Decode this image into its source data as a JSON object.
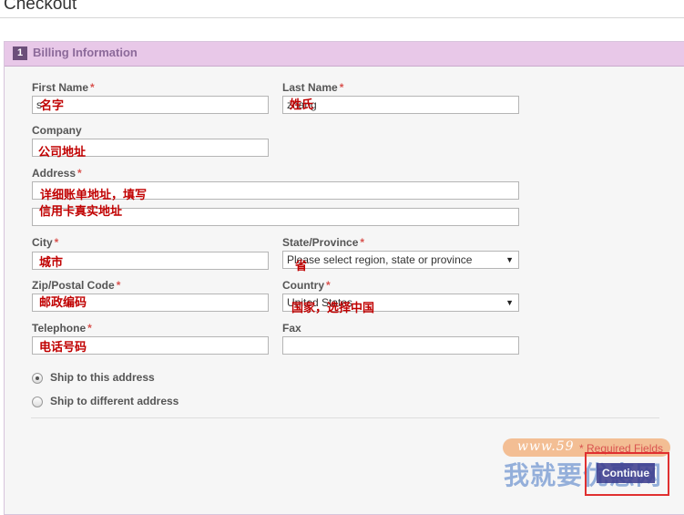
{
  "page": {
    "title": "Checkout"
  },
  "section": {
    "step": "1",
    "title": "Billing Information"
  },
  "fields": {
    "first_name": {
      "label": "First Name",
      "value": "s",
      "note": "名字"
    },
    "last_name": {
      "label": "Last Name",
      "value": "zhang",
      "note": "姓氏"
    },
    "company": {
      "label": "Company",
      "value": "",
      "note": "公司地址"
    },
    "address": {
      "label": "Address",
      "line1": "",
      "line2": "",
      "note1": "详细账单地址，填写",
      "note2": "信用卡真实地址"
    },
    "city": {
      "label": "City",
      "value": "",
      "note": "城市"
    },
    "state": {
      "label": "State/Province",
      "value": "Please select region, state or province",
      "note": "省"
    },
    "zip": {
      "label": "Zip/Postal Code",
      "value": "",
      "note": "邮政编码"
    },
    "country": {
      "label": "Country",
      "value": "United States",
      "note": "国家，选择中国"
    },
    "telephone": {
      "label": "Telephone",
      "value": "",
      "note": "电话号码"
    },
    "fax": {
      "label": "Fax",
      "value": ""
    },
    "required_mark": "*"
  },
  "shipping": {
    "option1": "Ship to this address",
    "option2": "Ship to different address",
    "selected": "option1"
  },
  "footer": {
    "required_fields": "* Required Fields",
    "continue": "Continue"
  },
  "watermark": {
    "url": "www.59",
    "text": "我就要优惠网"
  },
  "colors": {
    "accent": "#8c6a9a",
    "header_bg": "#e8c8e8",
    "note": "#c00000",
    "required": "#d9534f"
  },
  "icons": {
    "dropdown": "chevron-down-icon",
    "radio": "radio-icon"
  }
}
